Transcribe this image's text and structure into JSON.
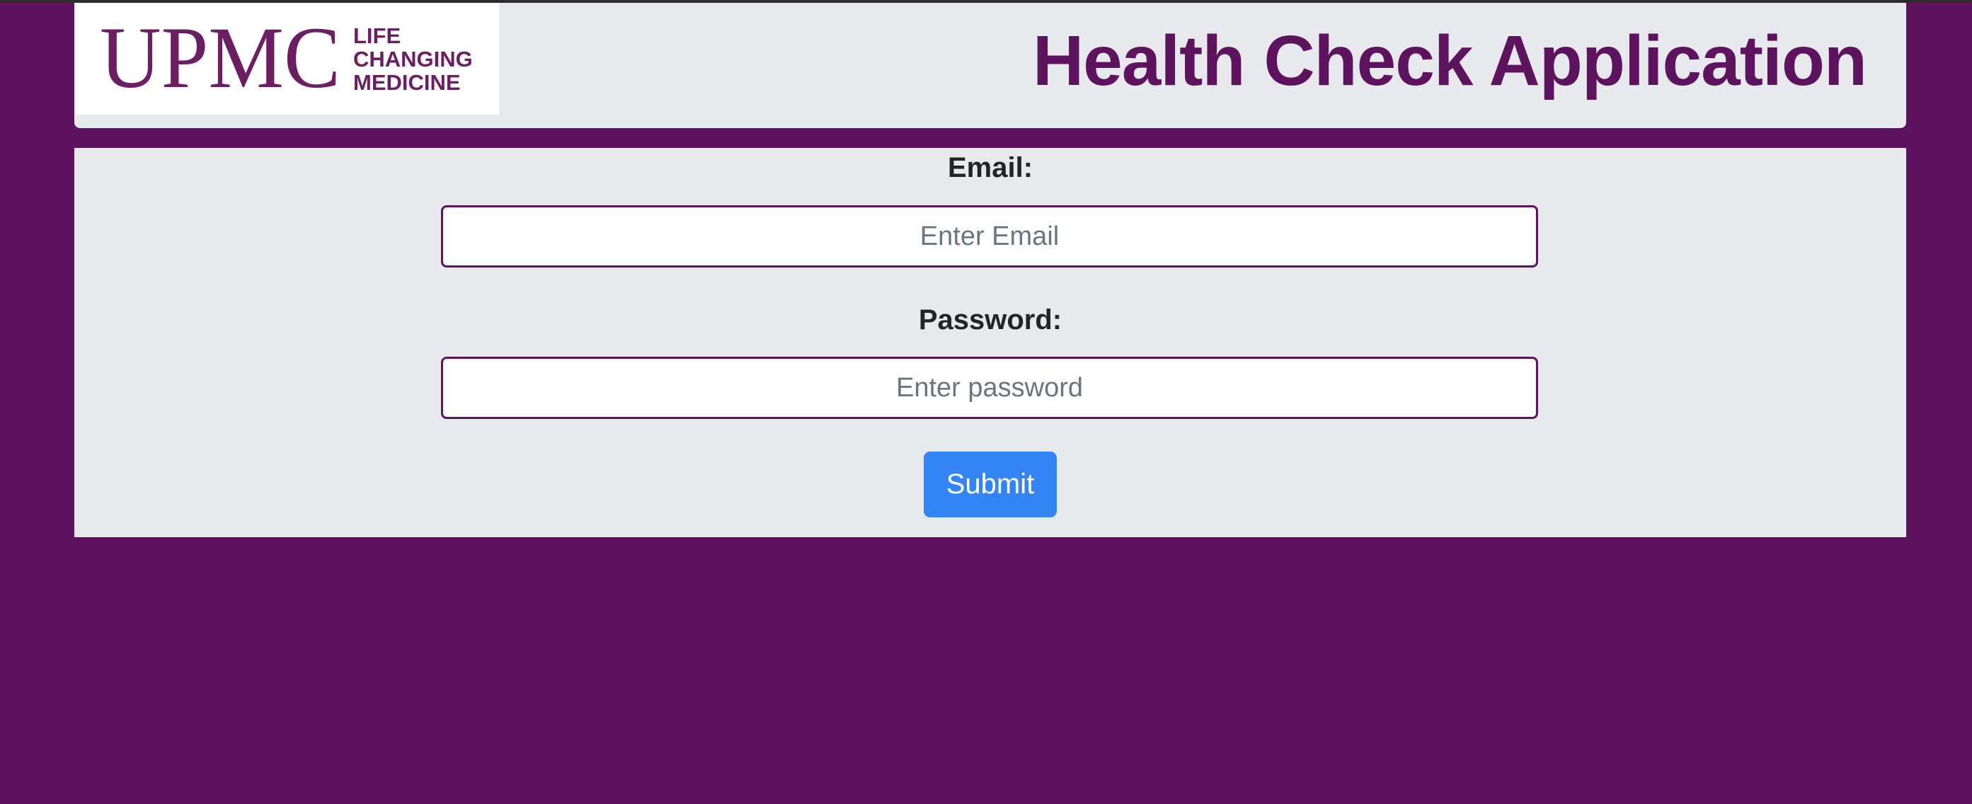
{
  "header": {
    "logo": {
      "wordmark": "UPMC",
      "tagline_lines": [
        "LIFE",
        "CHANGING",
        "MEDICINE"
      ]
    },
    "title": "Health Check Application"
  },
  "form": {
    "email": {
      "label": "Email:",
      "placeholder": "Enter Email",
      "value": ""
    },
    "password": {
      "label": "Password:",
      "placeholder": "Enter password",
      "value": ""
    },
    "submit_label": "Submit"
  },
  "colors": {
    "page_background": "#5e135f",
    "panel_background": "#e7e9ed",
    "brand_purple": "#5e135f",
    "logo_purple": "#6b1f62",
    "input_border": "#5e135f",
    "submit_button": "#3584f6",
    "label_text": "#212529",
    "placeholder_text": "#6c757d"
  }
}
